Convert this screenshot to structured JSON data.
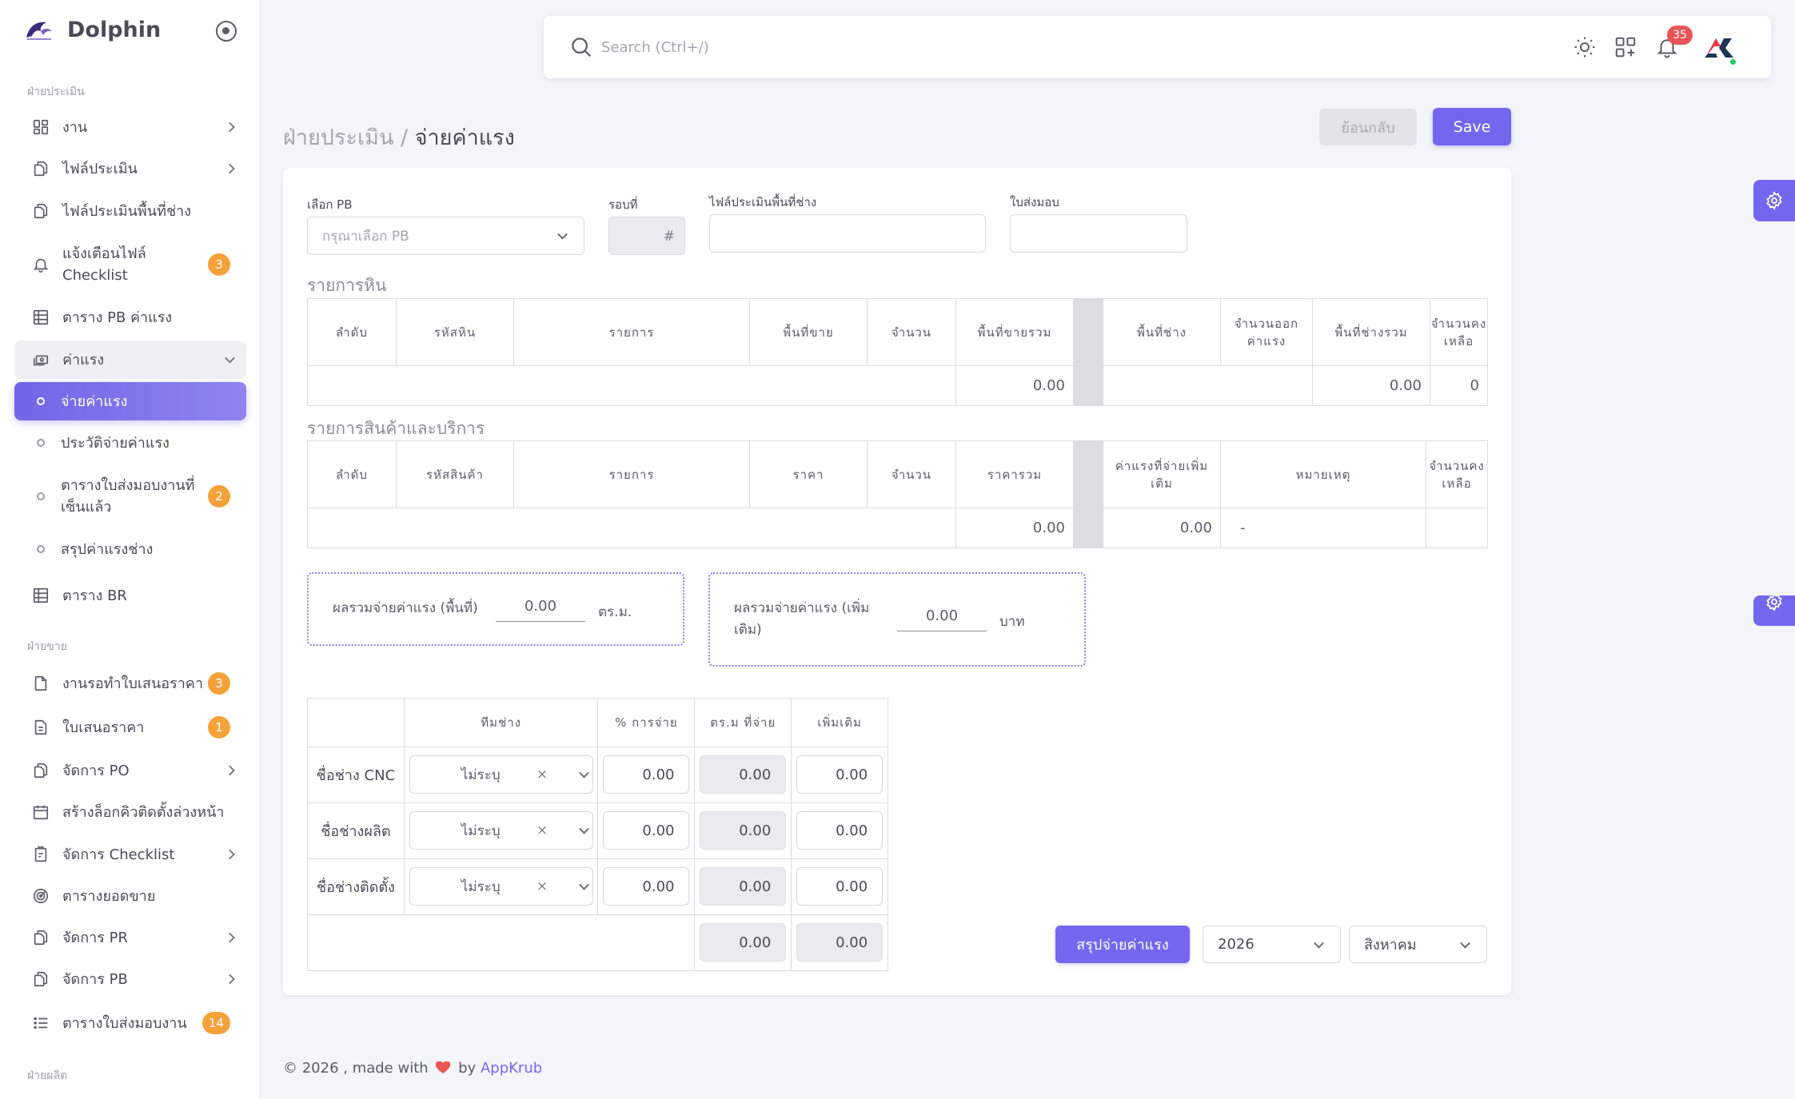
{
  "app": {
    "name": "Dolphin"
  },
  "sidebar": {
    "sections": [
      "ฝ่ายประเมิน",
      "ฝ่ายขาย",
      "ฝ่ายผลิต"
    ],
    "items": [
      {
        "label": "งาน",
        "icon": "layout-icon"
      },
      {
        "label": "ไฟล์ประเมิน",
        "icon": "files-icon"
      },
      {
        "label": "ไฟล์ประเมินพื้นที่ช่าง",
        "icon": "files-icon"
      },
      {
        "label": "แจ้งเตือนไฟล์",
        "label2": "Checklist",
        "badge": "3",
        "icon": "bell-icon"
      },
      {
        "label": "ตาราง PB ค่าแรง",
        "icon": "table-icon"
      },
      {
        "label": "ค่าแรง",
        "icon": "cash-icon"
      },
      {
        "label": "จ่ายค่าแรง"
      },
      {
        "label": "ประวัติจ่ายค่าแรง"
      },
      {
        "label": "ตารางใบส่งมอบงานที่",
        "label2": "เซ็นแล้ว",
        "badge": "2"
      },
      {
        "label": "สรุปค่าแรงช่าง"
      },
      {
        "label": "ตาราง BR",
        "icon": "table-icon"
      },
      {
        "label": "งานรอทำใบเสนอราคา",
        "badge": "3",
        "icon": "file-icon"
      },
      {
        "label": "ใบเสนอราคา",
        "badge": "1",
        "icon": "file-text-icon"
      },
      {
        "label": "จัดการ PO",
        "icon": "files-icon"
      },
      {
        "label": "สร้างล็อกคิวติดตั้งล่วงหน้า",
        "icon": "calendar-icon"
      },
      {
        "label": "จัดการ Checklist",
        "icon": "clipboard-icon"
      },
      {
        "label": "ตารางยอดขาย",
        "icon": "target-icon"
      },
      {
        "label": "จัดการ PR",
        "icon": "files-icon"
      },
      {
        "label": "จัดการ PB",
        "icon": "files-icon"
      },
      {
        "label": "ตารางใบส่งมอบงาน",
        "badge": "14",
        "icon": "list-icon"
      }
    ]
  },
  "topbar": {
    "search_placeholder": "Search (Ctrl+/)",
    "notification_count": "35"
  },
  "page": {
    "breadcrumb_parent": "ฝ่ายประเมิน / ",
    "breadcrumb_current": "จ่ายค่าแรง",
    "back_label": "ย้อนกลับ",
    "save_label": "Save"
  },
  "form": {
    "pb_label": "เลือก PB",
    "pb_placeholder": "กรุณาเลือก PB",
    "round_label": "รอบที่",
    "round_hash": "#",
    "area_file_label": "ไฟล์ประเมินพื้นที่ช่าง",
    "delivery_label": "ใบส่งมอบ"
  },
  "stone": {
    "title": "รายการหิน",
    "headers": [
      "ลำดับ",
      "รหัสหิน",
      "รายการ",
      "พื้นที่ขาย",
      "จำนวน",
      "พื้นที่ขายรวม",
      "พื้นที่ช่าง",
      "จำนวนออก ค่าแรง",
      "พื้นที่ช่างรวม",
      "จำนวนคง เหลือ"
    ],
    "totals": {
      "sale_area": "0.00",
      "tech_area": "0.00",
      "remaining": "0"
    }
  },
  "goods": {
    "title": "รายการสินค้าและบริการ",
    "headers": [
      "ลำดับ",
      "รหัสสินค้า",
      "รายการ",
      "ราคา",
      "จำนวน",
      "ราคารวม",
      "ค่าแรงที่จ่ายเพิ่ม เติม",
      "หมายเหตุ",
      "จำนวนคง เหลือ"
    ],
    "totals": {
      "total_price": "0.00",
      "extra_wage": "0.00",
      "note": "-"
    }
  },
  "summary": {
    "area_label": "ผลรวมจ่ายค่าแรง (พื้นที่)",
    "area_value": "0.00",
    "area_unit": "ตร.ม.",
    "extra_label": "ผลรวมจ่ายค่าแรง (เพิ่ม เติม)",
    "extra_value": "0.00",
    "extra_unit": "บาท"
  },
  "team": {
    "headers": [
      "",
      "ทีมช่าง",
      "% การจ่าย",
      "ตร.ม ที่จ่าย",
      "เพิ่มเติม"
    ],
    "rows": [
      {
        "role": "ชื่อช่าง CNC",
        "team": "ไม่ระบุ",
        "percent": "0.00",
        "sqm": "0.00",
        "extra": "0.00"
      },
      {
        "role": "ชื่อช่างผลิต",
        "team": "ไม่ระบุ",
        "percent": "0.00",
        "sqm": "0.00",
        "extra": "0.00"
      },
      {
        "role": "ชื่อช่างติดตั้ง",
        "team": "ไม่ระบุ",
        "percent": "0.00",
        "sqm": "0.00",
        "extra": "0.00"
      }
    ],
    "total_sqm": "0.00",
    "total_extra": "0.00",
    "clear_symbol": "×"
  },
  "controls": {
    "summary_button": "สรุปจ่ายค่าแรง",
    "year": "2026",
    "month": "สิงหาคม"
  },
  "footer": {
    "prefix": "© 2026 , made with",
    "by": "by",
    "brand": "AppKrub"
  },
  "colors": {
    "primary": "#7367f0",
    "badge_orange": "#f5a13a",
    "badge_red": "#ea5455",
    "online": "#28c76f"
  }
}
